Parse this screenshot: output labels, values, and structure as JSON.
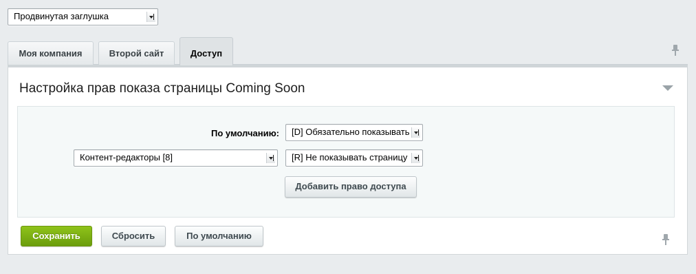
{
  "top_select": {
    "value": "Продвинутая заглушка"
  },
  "tabs": [
    {
      "label": "Моя компания"
    },
    {
      "label": "Второй сайт"
    },
    {
      "label": "Доступ"
    }
  ],
  "panel": {
    "title": "Настройка прав показа страницы Coming Soon",
    "default_label": "По умолчанию:",
    "default_right": "[D] Обязательно показывать",
    "group_select": "Контент-редакторы [8]",
    "group_right": "[R] Не показывать страницу",
    "add_button": "Добавить право доступа"
  },
  "footer": {
    "save": "Сохранить",
    "reset": "Сбросить",
    "default": "По умолчанию"
  },
  "colors": {
    "accent_green": "#7cb212",
    "background": "#e9ecee"
  }
}
